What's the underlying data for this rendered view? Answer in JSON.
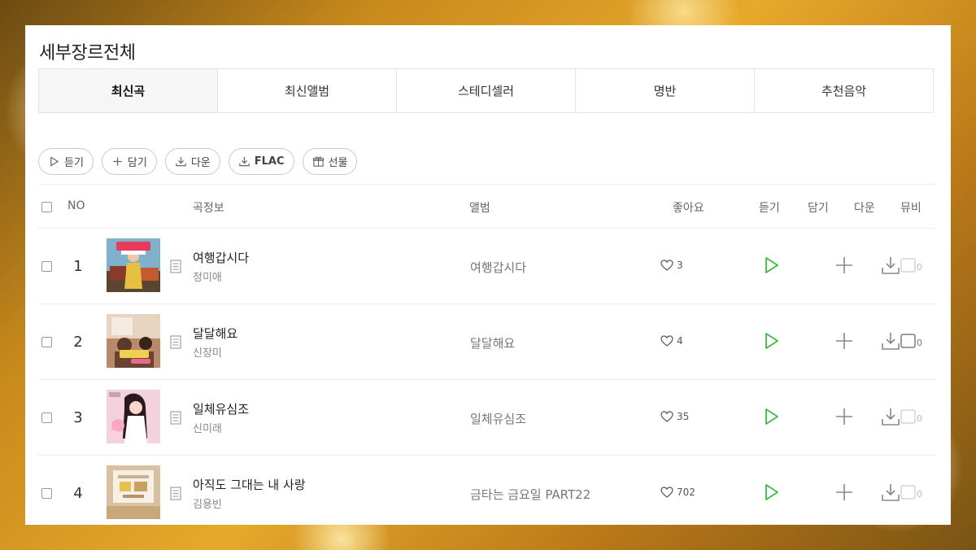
{
  "header": {
    "title": "세부장르전체"
  },
  "tabs": [
    {
      "label": "최신곡",
      "active": true
    },
    {
      "label": "최신앨범",
      "active": false
    },
    {
      "label": "스테디셀러",
      "active": false
    },
    {
      "label": "명반",
      "active": false
    },
    {
      "label": "추천음악",
      "active": false
    }
  ],
  "actions": {
    "play": "듣기",
    "add": "담기",
    "download": "다운",
    "flac": "FLAC",
    "gift": "선물"
  },
  "table_header": {
    "no": "NO",
    "song_info": "곡정보",
    "album": "앨범",
    "likes": "좋아요",
    "play": "듣기",
    "add": "담기",
    "download": "다운",
    "mv": "뮤비"
  },
  "rows": [
    {
      "rank": "1",
      "title": "여행갑시다",
      "artist": "정미애",
      "album": "여행갑시다",
      "likes": "3",
      "mv_count": "0"
    },
    {
      "rank": "2",
      "title": "달달해요",
      "artist": "신장미",
      "album": "달달해요",
      "likes": "4",
      "mv_count": "0"
    },
    {
      "rank": "3",
      "title": "일체유심조",
      "artist": "신미래",
      "album": "일체유심조",
      "likes": "35",
      "mv_count": "0"
    },
    {
      "rank": "4",
      "title": "아직도 그대는 내 사랑",
      "artist": "김용빈",
      "album": "금타는 금요일 PART22",
      "likes": "702",
      "mv_count": "0"
    }
  ],
  "colors": {
    "play_green": "#3dbd3d",
    "icon_gray": "#888888"
  }
}
